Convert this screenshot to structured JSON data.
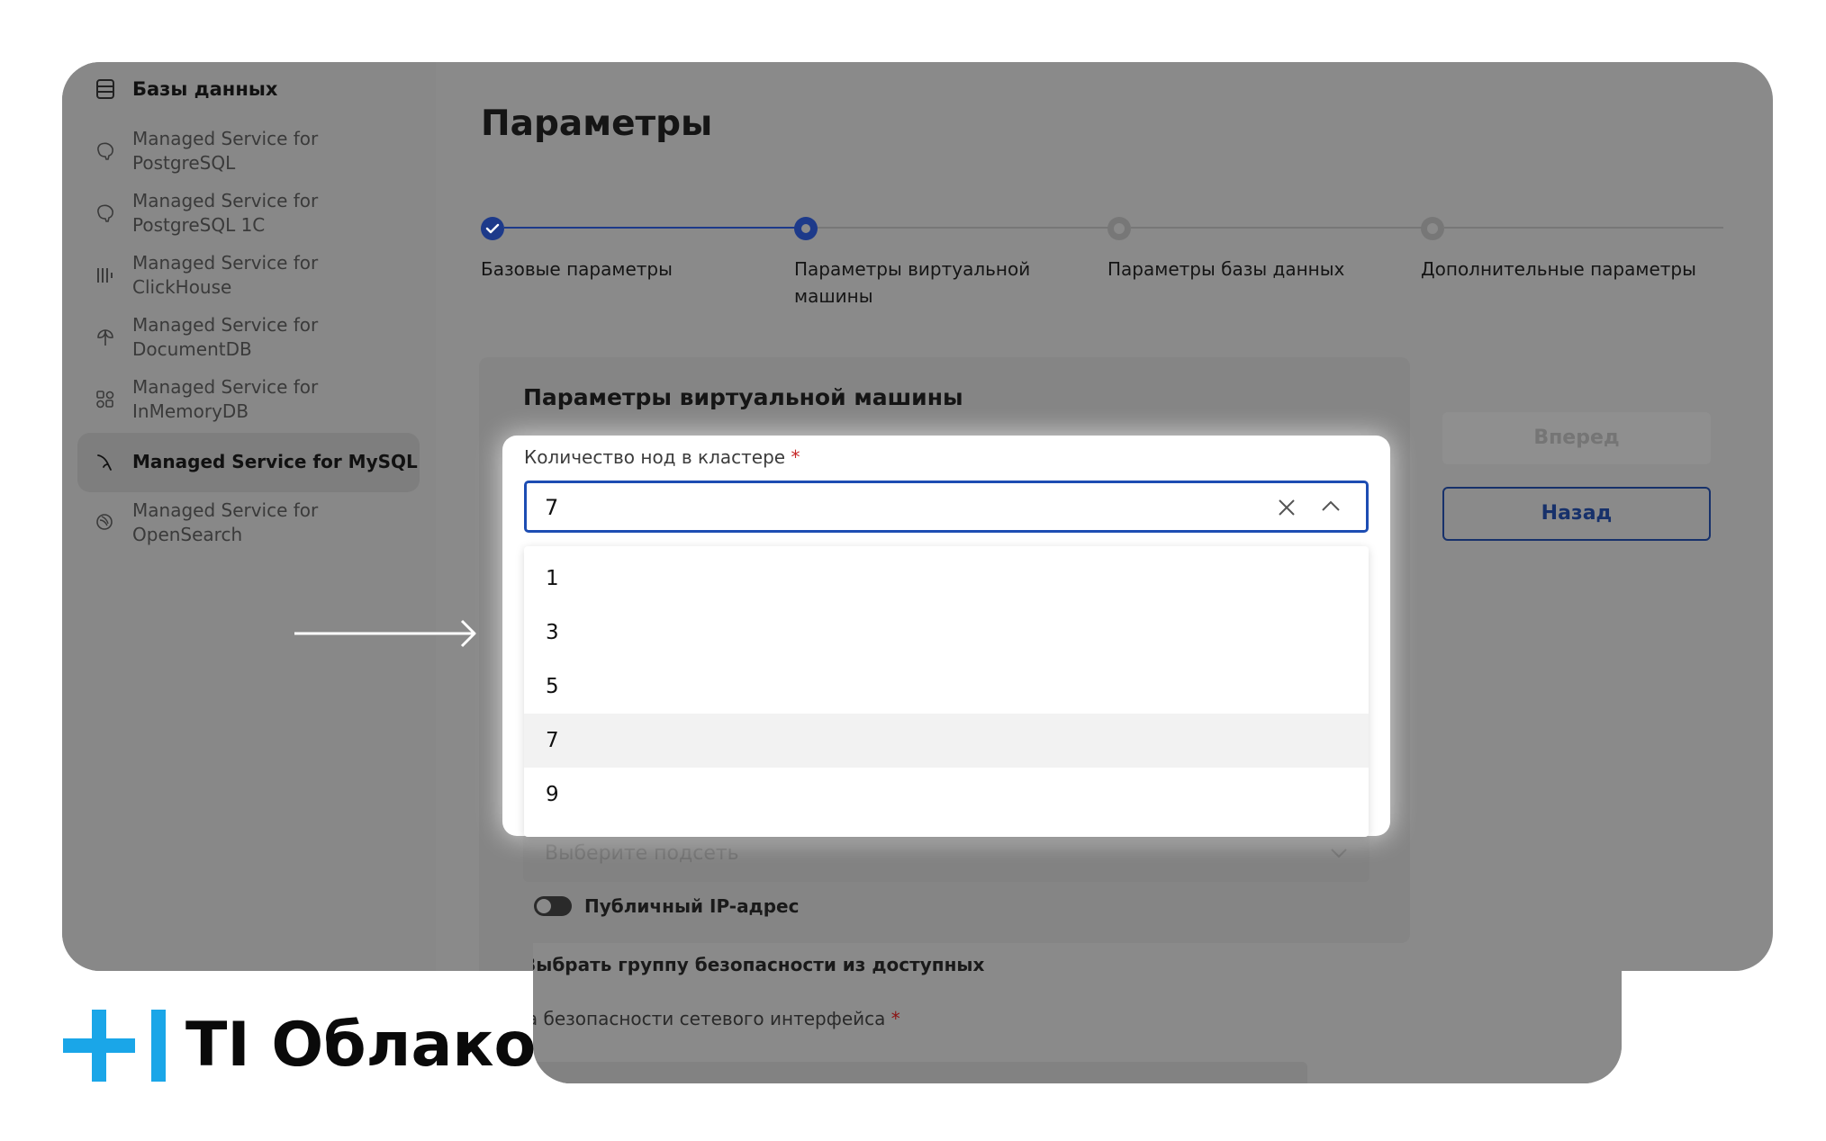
{
  "sidebar": {
    "header": "Базы данных",
    "items": [
      {
        "label": "Managed Service for PostgreSQL",
        "icon": "elephant-icon"
      },
      {
        "label": "Managed Service for PostgreSQL 1С",
        "icon": "elephant-icon"
      },
      {
        "label": "Managed Service for ClickHouse",
        "icon": "bars-icon"
      },
      {
        "label": "Managed Service for DocumentDB",
        "icon": "leaf-icon"
      },
      {
        "label": "Managed Service for InMemoryDB",
        "icon": "shapes-icon"
      },
      {
        "label": "Managed Service for MySQL",
        "icon": "dolphin-icon",
        "active": true
      },
      {
        "label": "Managed Service for OpenSearch",
        "icon": "opensearch-icon"
      }
    ]
  },
  "main": {
    "title": "Параметры",
    "steps": [
      {
        "label": "Базовые параметры",
        "state": "done"
      },
      {
        "label": "Параметры виртуальной машины",
        "state": "current"
      },
      {
        "label": "Параметры базы данных",
        "state": "pending"
      },
      {
        "label": "Дополнительные параметры",
        "state": "pending"
      }
    ],
    "panel_title": "Параметры виртуальной машины",
    "forward_label": "Вперед",
    "back_label": "Назад",
    "subnet_placeholder": "Выберите подсеть",
    "public_ip_label": "Публичный IP-адрес",
    "security_group_toggle_label": "Выбрать группу безопасности из доступных",
    "security_group_field_label": "Группа безопасности сетевого интерфейса"
  },
  "node_count": {
    "label": "Количество нод в кластере",
    "required_mark": "*",
    "value": "7",
    "options": [
      "1",
      "3",
      "5",
      "7",
      "9"
    ],
    "selected": "7"
  },
  "logo": {
    "text": "TI Облако"
  },
  "colors": {
    "accent": "#1d4db3",
    "logo_blue": "#1aa6e8",
    "overlay_gray": "#8a8a8a",
    "required": "#c62828"
  }
}
